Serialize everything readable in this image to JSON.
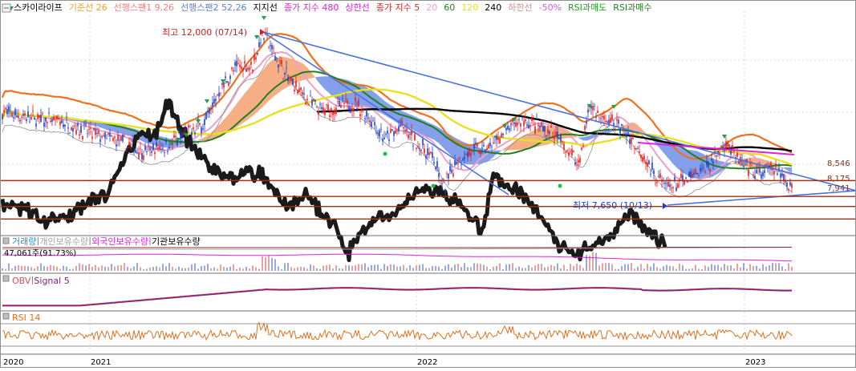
{
  "legend": [
    {
      "label": "스카이라이프",
      "color": "#000000"
    },
    {
      "label": "기준선 26",
      "color": "#f0a030"
    },
    {
      "label": "선행스팬1 9,26",
      "color": "#f08080"
    },
    {
      "label": "선행스팬2 52,26",
      "color": "#5a7ee0"
    },
    {
      "label": "지지선",
      "color": "#000000"
    },
    {
      "label": "종가 지수 480",
      "color": "#e020e0"
    },
    {
      "label": "상한선",
      "color": "#e020e0"
    },
    {
      "label": "종가 지수 5",
      "color": "#e02020"
    },
    {
      "label": "20",
      "color": "#f0a0d0"
    },
    {
      "label": "60",
      "color": "#208020"
    },
    {
      "label": "120",
      "color": "#e8e020"
    },
    {
      "label": "240",
      "color": "#000000"
    },
    {
      "label": "하한선",
      "color": "#d09090"
    },
    {
      "label": "-50%",
      "color": "#d060d0"
    },
    {
      "label": "RSI과매도",
      "color": "#20a020"
    },
    {
      "label": "RSI과매수",
      "color": "#208020"
    }
  ],
  "annotations": {
    "high": "최고 12,000 (07/14)",
    "low": "최저 7,650 (10/13)"
  },
  "price_labels": [
    "8,546",
    "8,175",
    "7,941"
  ],
  "sub_legends": {
    "volume": [
      {
        "label": "거래량",
        "color": "#2a8cc8"
      },
      {
        "label": "개인보유수량",
        "color": "#a0a0a0"
      },
      {
        "label": "외국인보유수량",
        "color": "#e020e0"
      },
      {
        "label": "기관보유수량",
        "color": "#000000"
      }
    ],
    "volume_value": "47,061주(91.73%)",
    "obv": [
      {
        "label": "OBV",
        "color": "#e05050"
      },
      {
        "label": "Signal 5",
        "color": "#802080"
      }
    ],
    "rsi": [
      {
        "label": "RSI 14",
        "color": "#e07020"
      }
    ]
  },
  "x_labels": [
    "2020",
    "2021",
    "2022",
    "2023"
  ],
  "colors": {
    "up": "#e02020",
    "down": "#2040c0",
    "support": "#a03010",
    "trend": "#4a70e0",
    "grid": "#b8b8b8",
    "divider": "#707070"
  },
  "chart_data": {
    "type": "line",
    "title": "스카이라이프",
    "x": [
      "2020",
      "2021",
      "2022",
      "2023"
    ],
    "series": [
      {
        "name": "스카이라이프",
        "high": 12000,
        "high_date": "07/14",
        "low": 7650,
        "low_date": "10/13"
      }
    ],
    "support_levels": [
      8546,
      8175,
      7941
    ],
    "ylim": [
      7300,
      12500
    ],
    "grid": true
  }
}
